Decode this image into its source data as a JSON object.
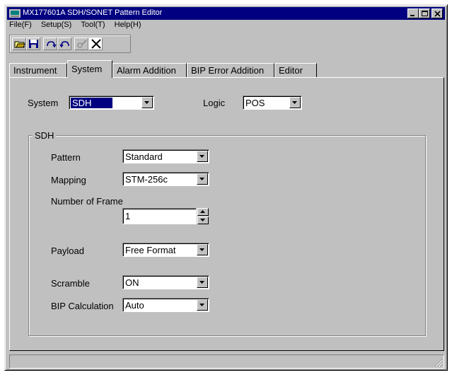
{
  "window": {
    "title": "MX177601A SDH/SONET Pattern Editor"
  },
  "menu": [
    "File(F)",
    "Setup(S)",
    "Tool(T)",
    "Help(H)"
  ],
  "toolbar": {
    "buttons": [
      "open-icon",
      "save-icon",
      "redo-icon",
      "undo-icon",
      "edit-icon",
      "close-icon"
    ]
  },
  "tabs": [
    "Instrument",
    "System",
    "Alarm Addition",
    "BIP Error Addition",
    "Editor"
  ],
  "active_tab": "System",
  "system": {
    "system_label": "System",
    "system_value": "SDH",
    "logic_label": "Logic",
    "logic_value": "POS"
  },
  "sdh_group": {
    "title": "SDH",
    "pattern_label": "Pattern",
    "pattern_value": "Standard",
    "mapping_label": "Mapping",
    "mapping_value": "STM-256c",
    "frames_label": "Number of Frame",
    "frames_value": "1",
    "payload_label": "Payload",
    "payload_value": "Free Format",
    "scramble_label": "Scramble",
    "scramble_value": "ON",
    "bip_label": "BIP Calculation",
    "bip_value": "Auto"
  },
  "colors": {
    "face": "#c0c0c0",
    "titlebar": "#000080",
    "selection": "#000080"
  }
}
